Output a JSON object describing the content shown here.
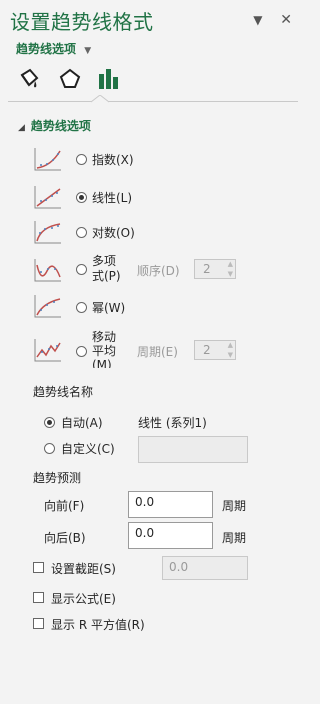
{
  "header": {
    "title": "设置趋势线格式",
    "dropdown_icon": "chevron-down-icon",
    "close_icon": "close-icon"
  },
  "subtitle": "趋势线选项",
  "tabs": [
    {
      "name": "fill-line",
      "icon": "paint-bucket-icon"
    },
    {
      "name": "effects",
      "icon": "pentagon-icon"
    },
    {
      "name": "options",
      "icon": "bar-chart-icon",
      "active": true
    }
  ],
  "section_title": "趋势线选项",
  "trend_types": [
    {
      "label": "指数(X)",
      "selected": false
    },
    {
      "label": "线性(L)",
      "selected": true
    },
    {
      "label": "对数(O)",
      "selected": false
    },
    {
      "label": "多项式(P)",
      "line1": "多项",
      "line2": "式(P)",
      "selected": false
    },
    {
      "label": "幂(W)",
      "selected": false
    },
    {
      "label": "移动平均(M)",
      "line1": "移动",
      "line2": "平均",
      "line3": "(M)",
      "selected": false
    }
  ],
  "order": {
    "label": "顺序(D)",
    "value": "2"
  },
  "period": {
    "label": "周期(E)",
    "value": "2"
  },
  "name_section": {
    "title": "趋势线名称",
    "auto_label": "自动(A)",
    "auto_value": "线性 (系列1)",
    "custom_label": "自定义(C)",
    "custom_value": ""
  },
  "forecast": {
    "title": "趋势预测",
    "forward_label": "向前(F)",
    "forward_value": "0.0",
    "backward_label": "向后(B)",
    "backward_value": "0.0",
    "unit": "周期"
  },
  "intercept": {
    "label": "设置截距(S)",
    "value": "0.0",
    "checked": false
  },
  "show_equation": {
    "label": "显示公式(E)",
    "checked": false
  },
  "show_r2": {
    "label": "显示 R 平方值(R)",
    "checked": false
  },
  "colors": {
    "accent": "#217346",
    "panel_bg": "#f3f3f3"
  }
}
